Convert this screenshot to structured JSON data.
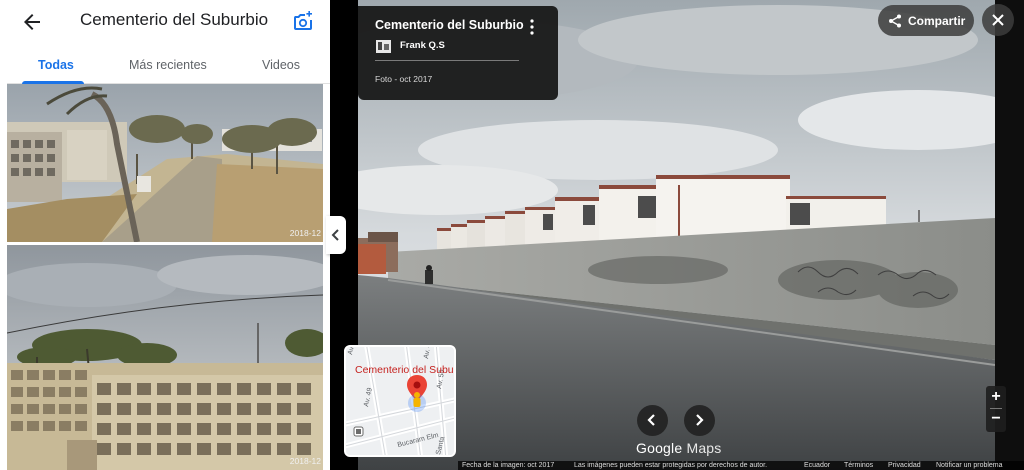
{
  "panel": {
    "title": "Cementerio del Suburbio",
    "tabs": [
      {
        "label": "Todas",
        "active": true
      },
      {
        "label": "Más recientes",
        "active": false
      },
      {
        "label": "Videos",
        "active": false
      }
    ],
    "photos": [
      {
        "date": "2018-12"
      },
      {
        "date": "2018-12"
      }
    ]
  },
  "card": {
    "title": "Cementerio del Suburbio",
    "author": "Frank Q.S",
    "date": "Foto - oct 2017"
  },
  "actions": {
    "share_label": "Compartir"
  },
  "minimap": {
    "place_label": "Cementerio del Subu",
    "streets": [
      "Av. 49",
      "Av. 48",
      "Av. 50",
      "Av. 51",
      "Bucaram Elm",
      "Santa"
    ]
  },
  "brand": {
    "google": "Google",
    "maps": "Maps"
  },
  "zoom": {
    "in": "+",
    "out": "−"
  },
  "footer": {
    "image_date": "Fecha de la imagen: oct 2017",
    "rights": "Las imágenes pueden estar protegidas por derechos de autor.",
    "country": "Ecuador",
    "terms": "Términos",
    "privacy": "Privacidad",
    "report": "Notificar un problema"
  },
  "colors": {
    "accent": "#1a73e8",
    "pin": "#ea4335",
    "card_bg": "#181818"
  },
  "icons": [
    "back-arrow-icon",
    "add-photo-icon",
    "chevron-left-icon",
    "more-vert-icon",
    "share-icon",
    "close-icon",
    "chevron-right-icon",
    "map-pin-icon",
    "pegman-icon"
  ]
}
